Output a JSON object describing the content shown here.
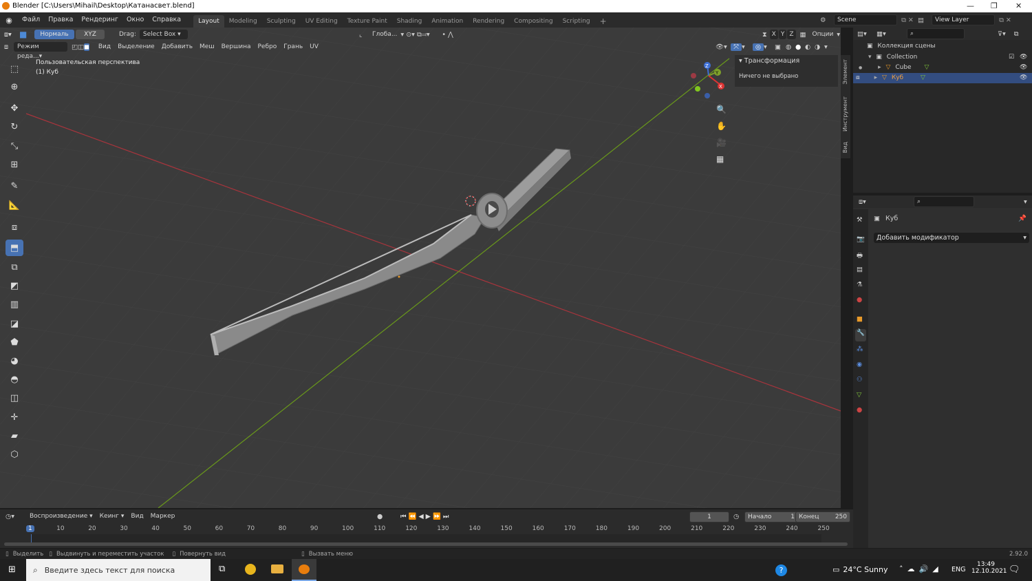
{
  "window": {
    "title": "Blender [C:\\Users\\Mihail\\Desktop\\Катанасвет.blend]"
  },
  "menu": [
    "Файл",
    "Правка",
    "Рендеринг",
    "Окно",
    "Справка"
  ],
  "workspaces": [
    "Layout",
    "Modeling",
    "Sculpting",
    "UV Editing",
    "Texture Paint",
    "Shading",
    "Animation",
    "Rendering",
    "Compositing",
    "Scripting"
  ],
  "active_workspace": "Layout",
  "scene": {
    "name": "Scene",
    "view_layer": "View Layer"
  },
  "viewport_header": {
    "mode_buttons": [
      "Нормаль",
      "XYZ"
    ],
    "drag_label": "Drag:",
    "drag_value": "Select Box",
    "transform_orient": "Глоба...",
    "options_label": "Опции",
    "edit_mode": "Режим реда...",
    "edit_menus": [
      "Вид",
      "Выделение",
      "Добавить",
      "Меш",
      "Вершина",
      "Ребро",
      "Грань",
      "UV"
    ],
    "axes": [
      "X",
      "Y",
      "Z"
    ]
  },
  "viewport": {
    "view_name": "Пользовательская перспектива",
    "object_name": "(1) Куб",
    "gizmo": {
      "z": "Z",
      "y": "Y",
      "x": "X"
    }
  },
  "npanel": {
    "section": "Трансформация",
    "content": "Ничего не выбрано",
    "tabs": [
      "Элемент",
      "Инструмент",
      "Вид"
    ]
  },
  "outliner": {
    "root": "Коллекция сцены",
    "collection": "Collection",
    "items": [
      {
        "name": "Cube",
        "selected": false
      },
      {
        "name": "Куб",
        "selected": true
      }
    ]
  },
  "properties": {
    "object_name": "Куб",
    "add_modifier": "Добавить модификатор"
  },
  "timeline": {
    "menus": [
      "Воспроизведение",
      "Кеинг",
      "Вид",
      "Маркер"
    ],
    "current_frame": "1",
    "start_label": "Начало",
    "start": "1",
    "end_label": "Конец",
    "end": "250",
    "ruler": [
      "1",
      "10",
      "20",
      "30",
      "40",
      "50",
      "60",
      "70",
      "80",
      "90",
      "100",
      "110",
      "120",
      "130",
      "140",
      "150",
      "160",
      "170",
      "180",
      "190",
      "200",
      "210",
      "220",
      "230",
      "240",
      "250"
    ]
  },
  "statusbar": {
    "select": "Выделить",
    "box_move": "Выдвинуть и переместить участок",
    "rotate": "Повернуть вид",
    "menu": "Вызвать меню",
    "version": "2.92.0"
  },
  "taskbar": {
    "search_placeholder": "Введите здесь текст для поиска",
    "weather": "24°C  Sunny",
    "lang": "ENG",
    "time": "13:49",
    "date": "12.10.2021"
  },
  "colors": {
    "accent": "#4772b3",
    "x_axis": "#b33a45",
    "y_axis": "#6b9a1f",
    "viewport_bg": "#3b3b3b"
  }
}
